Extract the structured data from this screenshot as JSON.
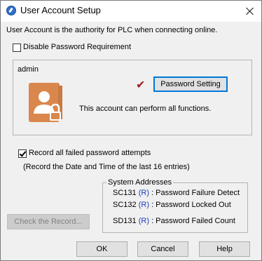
{
  "window": {
    "title": "User Account Setup",
    "description": "User Account is the authority for PLC when connecting online."
  },
  "disable_password": {
    "label": "Disable Password Requirement",
    "checked": false
  },
  "account": {
    "name": "admin",
    "password_button": "Password Setting",
    "permission_text": "This account can perform all functions.",
    "icon": "user-lock-icon"
  },
  "record_failed": {
    "label": "Record all failed password attempts",
    "checked": true,
    "note": "(Record the Date and Time of the last 16 entries)"
  },
  "system_addresses": {
    "legend": "System Addresses",
    "entries": [
      {
        "address": "SC131",
        "access": "R",
        "description": ": Password Failure Detect"
      },
      {
        "address": "SC132",
        "access": "R",
        "description": ": Password Locked Out"
      },
      {
        "address": "SD131",
        "access": "R",
        "description": ": Password Failed Count"
      }
    ]
  },
  "buttons": {
    "check_record": "Check the Record...",
    "ok": "OK",
    "cancel": "Cancel",
    "help": "Help"
  },
  "colors": {
    "icon_orange": "#d9874d",
    "check_red": "#a02020",
    "register_blue": "#1f3ab8",
    "default_border": "#0078d7"
  }
}
